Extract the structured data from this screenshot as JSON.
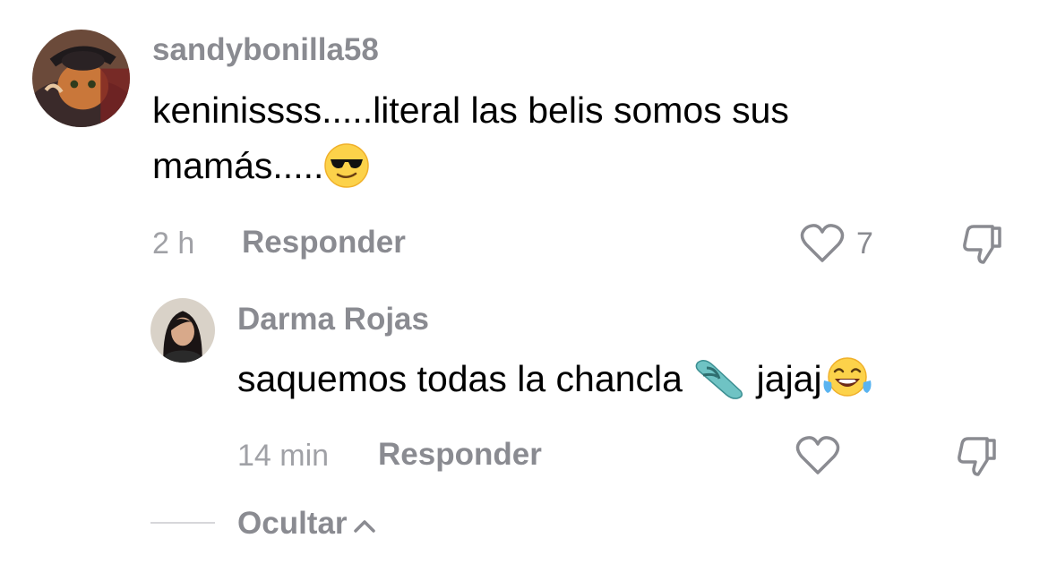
{
  "comments": [
    {
      "username": "sandybonilla58",
      "text_line1": "keninissss.....literal las belis somos sus",
      "text_line2": "mamás.....",
      "text_emoji": "smiling-face-with-sunglasses",
      "time": "2 h",
      "reply_label": "Responder",
      "likes": "7"
    }
  ],
  "reply": {
    "username": "Darma Rojas",
    "text_part1": "saquemos todas la chancla ",
    "text_emoji1": "thong-sandal",
    "text_part2": " jajaj",
    "text_emoji2": "face-with-tears-of-joy",
    "time": "14 min",
    "reply_label": "Responder"
  },
  "hide_label": "Ocultar",
  "colors": {
    "username": "#8a8b91",
    "meta": "#a0a1a6",
    "text": "#000000"
  }
}
